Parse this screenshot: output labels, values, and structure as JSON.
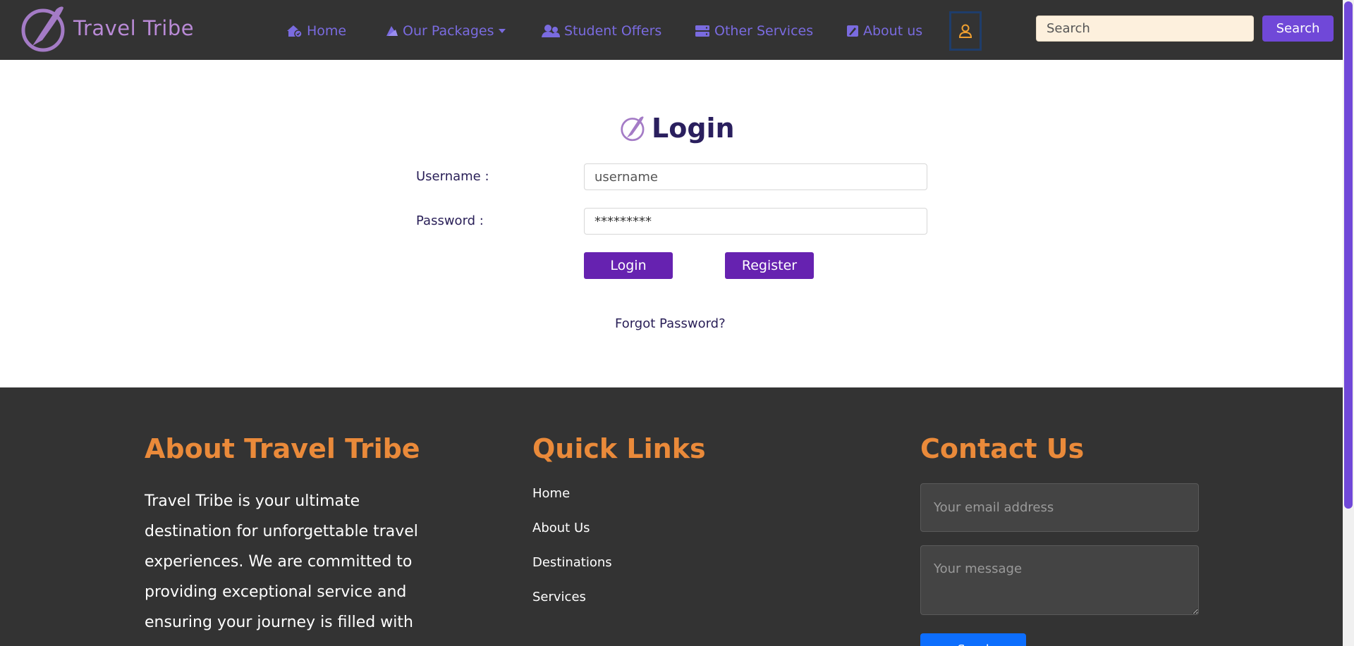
{
  "brand": {
    "name": "Travel Tribe"
  },
  "nav": {
    "items": [
      {
        "label": "Home",
        "icon": "house-icon"
      },
      {
        "label": "Our Packages",
        "icon": "sail-icon"
      },
      {
        "label": "Student Offers",
        "icon": "users-icon"
      },
      {
        "label": "Other Services",
        "icon": "server-icon"
      },
      {
        "label": "About us",
        "icon": "note-icon"
      }
    ],
    "user_icon": "user-icon",
    "search_placeholder": "Search",
    "search_button": "Search"
  },
  "login": {
    "title": "Login",
    "username_label": "Username :",
    "username_placeholder": "username",
    "password_label": "Password :",
    "password_value": "*********",
    "login_button": "Login",
    "register_button": "Register",
    "forgot_link": "Forgot Password?"
  },
  "footer": {
    "about": {
      "heading": "About Travel Tribe",
      "text": "Travel Tribe is your ultimate destination for unforgettable travel experiences. We are committed to providing exceptional service and ensuring your journey is filled with"
    },
    "quick_links": {
      "heading": "Quick Links",
      "items": [
        "Home",
        "About Us",
        "Destinations",
        "Services"
      ]
    },
    "contact": {
      "heading": "Contact Us",
      "email_placeholder": "Your email address",
      "message_placeholder": "Your message",
      "send_button": "Send"
    }
  },
  "colors": {
    "navbar_bg": "#333333",
    "nav_link": "#7a6be0",
    "brand": "#b98ad6",
    "primary_button": "#6622b0",
    "search_button": "#7048d8",
    "footer_heading": "#ea8a3a",
    "send_button": "#0d6efd"
  }
}
